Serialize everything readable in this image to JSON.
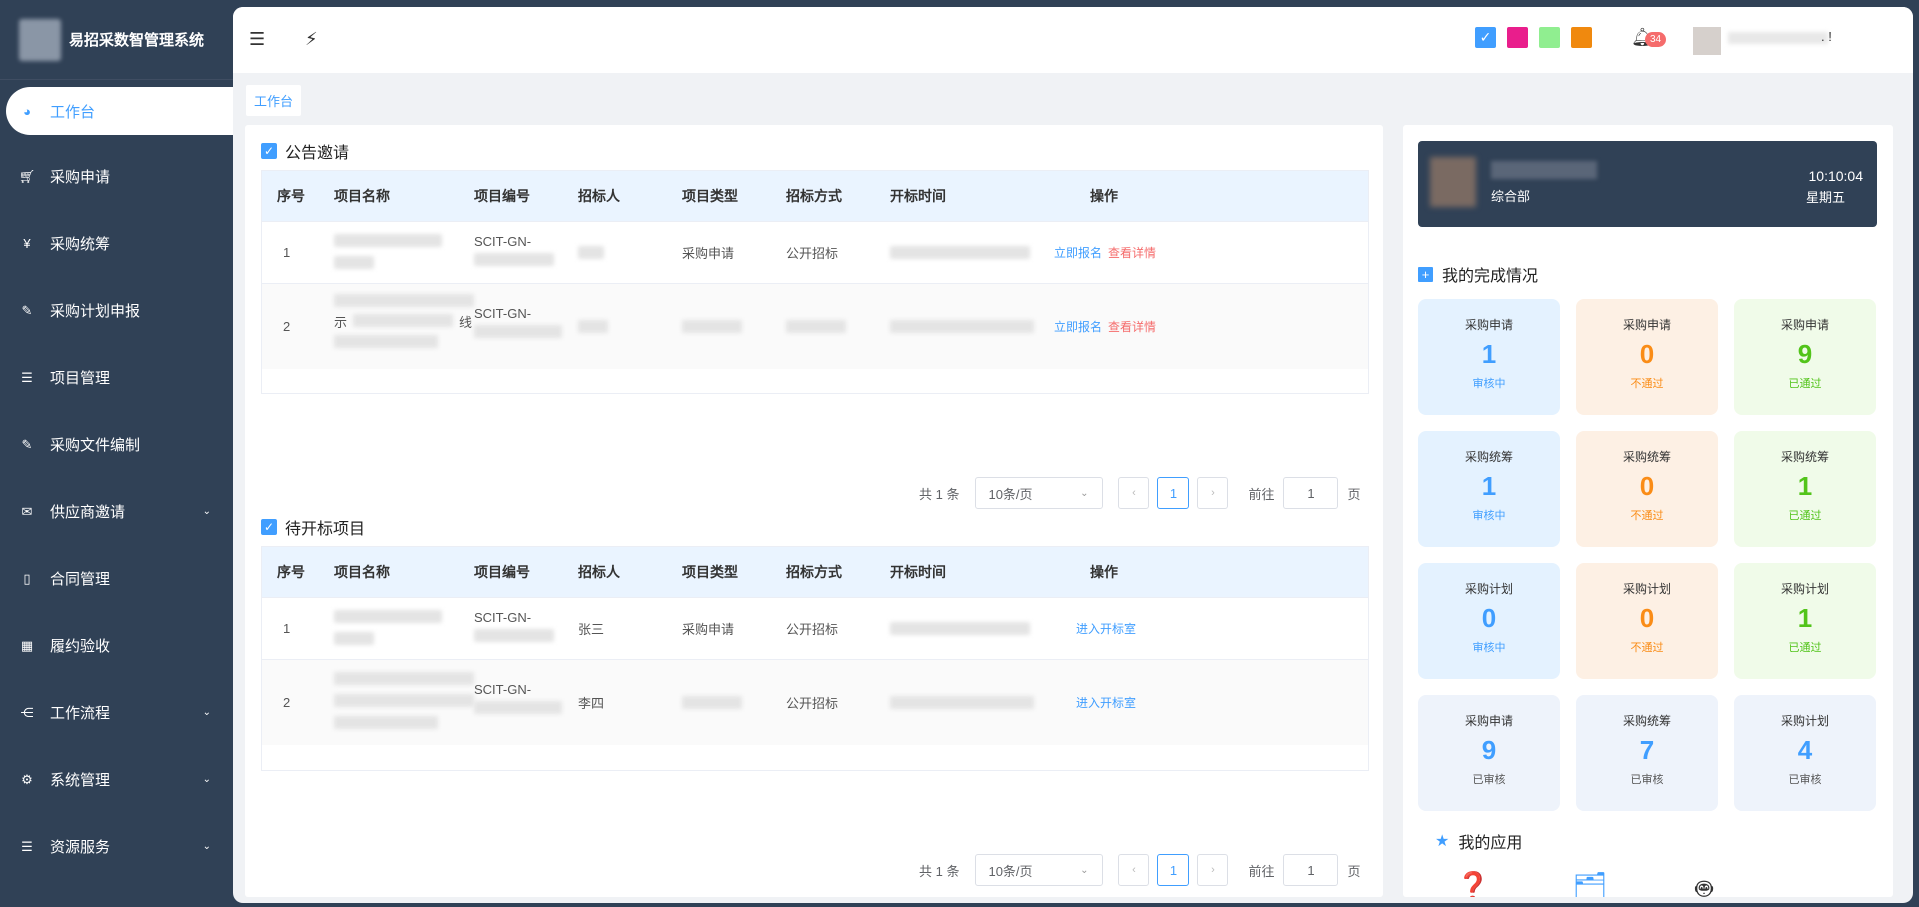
{
  "app": {
    "title": "易招采数智管理系统"
  },
  "sidebar": {
    "items": [
      {
        "label": "工作台",
        "icon": "dashboard-icon"
      },
      {
        "label": "采购申请",
        "icon": "cart-icon"
      },
      {
        "label": "采购统筹",
        "icon": "yen-icon"
      },
      {
        "label": "采购计划申报",
        "icon": "edit-icon"
      },
      {
        "label": "项目管理",
        "icon": "list-icon"
      },
      {
        "label": "采购文件编制",
        "icon": "edit-icon"
      },
      {
        "label": "供应商邀请",
        "icon": "mail-icon"
      },
      {
        "label": "合同管理",
        "icon": "book-icon"
      },
      {
        "label": "履约验收",
        "icon": "grid-icon"
      },
      {
        "label": "工作流程",
        "icon": "share-icon"
      },
      {
        "label": "系统管理",
        "icon": "gear-icon"
      },
      {
        "label": "资源服务",
        "icon": "list-icon"
      }
    ]
  },
  "header": {
    "notifications": "34",
    "user_suffix": ". !",
    "theme_colors": [
      "#409eff",
      "#e91e8c",
      "#90ee90",
      "#f0890e"
    ]
  },
  "breadcrumb": "工作台",
  "announce": {
    "title": "公告邀请",
    "columns": [
      "序号",
      "项目名称",
      "项目编号",
      "招标人",
      "项目类型",
      "招标方式",
      "开标时间",
      "操作"
    ],
    "rows": [
      {
        "no": "1",
        "code": "SCIT-GN-",
        "type": "采购申请",
        "method": "公开招标",
        "act1": "立即报名",
        "act2": "查看详情"
      },
      {
        "no": "2",
        "name_frag1": "示",
        "name_frag2": "线",
        "code": "SCIT-GN-",
        "act1": "立即报名",
        "act2": "查看详情"
      }
    ],
    "pager": {
      "total": "共 1 条",
      "size": "10条/页",
      "page": "1",
      "goto": "前往",
      "goto_val": "1",
      "unit": "页"
    }
  },
  "pending": {
    "title": "待开标项目",
    "columns": [
      "序号",
      "项目名称",
      "项目编号",
      "招标人",
      "项目类型",
      "招标方式",
      "开标时间",
      "操作"
    ],
    "rows": [
      {
        "no": "1",
        "code": "SCIT-GN-",
        "bidder": "张三",
        "type": "采购申请",
        "method": "公开招标",
        "act": "进入开标室"
      },
      {
        "no": "2",
        "code": "SCIT-GN-",
        "bidder": "李四",
        "method": "公开招标",
        "act": "进入开标室"
      }
    ],
    "pager": {
      "total": "共 1 条",
      "size": "10条/页",
      "page": "1",
      "goto": "前往",
      "goto_val": "1",
      "unit": "页"
    }
  },
  "user": {
    "dept": "综合部",
    "time": "10:10:04",
    "weekday": "星期五"
  },
  "completion": {
    "title": "我的完成情况",
    "cards": [
      {
        "label": "采购申请",
        "num": "1",
        "status": "审核中"
      },
      {
        "label": "采购申请",
        "num": "0",
        "status": "不通过"
      },
      {
        "label": "采购申请",
        "num": "9",
        "status": "已通过"
      },
      {
        "label": "采购统筹",
        "num": "1",
        "status": "审核中"
      },
      {
        "label": "采购统筹",
        "num": "0",
        "status": "不通过"
      },
      {
        "label": "采购统筹",
        "num": "1",
        "status": "已通过"
      },
      {
        "label": "采购计划",
        "num": "0",
        "status": "审核中"
      },
      {
        "label": "采购计划",
        "num": "0",
        "status": "不通过"
      },
      {
        "label": "采购计划",
        "num": "1",
        "status": "已通过"
      },
      {
        "label": "采购申请",
        "num": "9",
        "status": "已审核"
      },
      {
        "label": "采购统筹",
        "num": "7",
        "status": "已审核"
      },
      {
        "label": "采购计划",
        "num": "4",
        "status": "已审核"
      }
    ]
  },
  "apps": {
    "title": "我的应用"
  }
}
